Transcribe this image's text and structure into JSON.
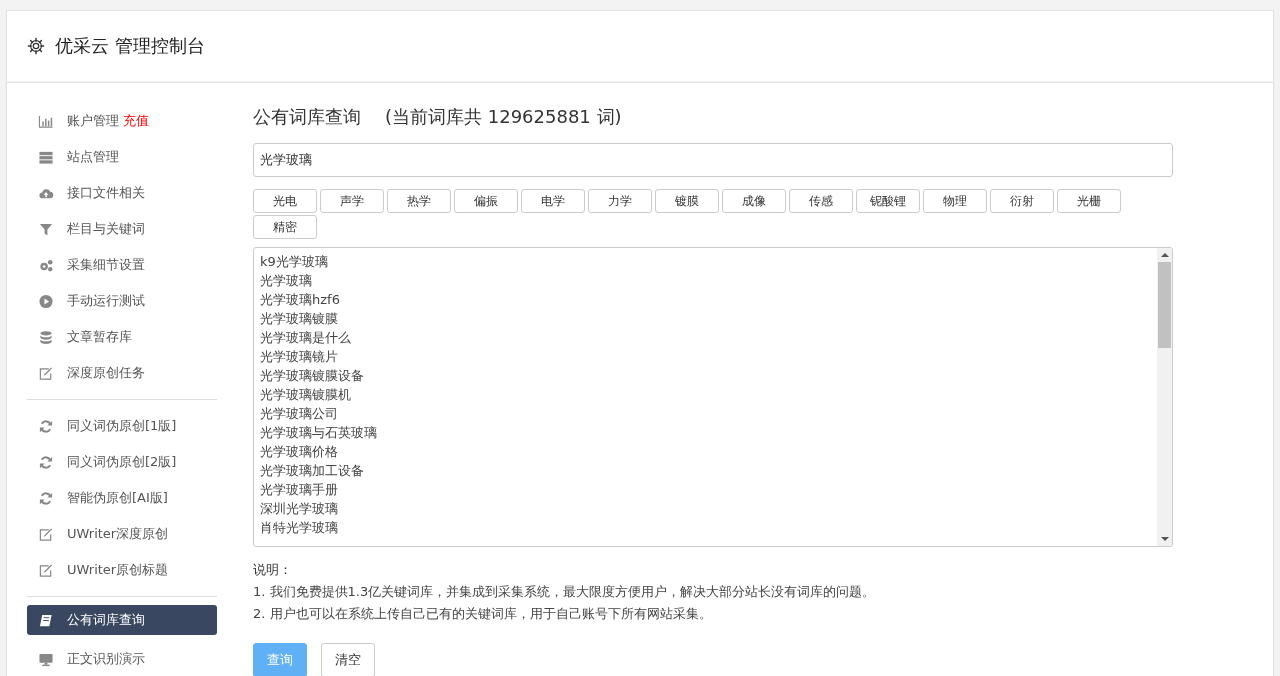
{
  "header": {
    "title": "优采云 管理控制台"
  },
  "sidebar": {
    "groups": [
      {
        "items": [
          {
            "label": "账户管理",
            "badge": "充值",
            "selected": false
          },
          {
            "label": "站点管理",
            "selected": false
          },
          {
            "label": "接口文件相关",
            "selected": false
          },
          {
            "label": "栏目与关键词",
            "selected": false
          },
          {
            "label": "采集细节设置",
            "selected": false
          },
          {
            "label": "手动运行测试",
            "selected": false
          },
          {
            "label": "文章暂存库",
            "selected": false
          },
          {
            "label": "深度原创任务",
            "selected": false
          }
        ]
      },
      {
        "items": [
          {
            "label": "同义词伪原创[1版]",
            "selected": false
          },
          {
            "label": "同义词伪原创[2版]",
            "selected": false
          },
          {
            "label": "智能伪原创[AI版]",
            "selected": false
          },
          {
            "label": "UWriter深度原创",
            "selected": false
          },
          {
            "label": "UWriter原创标题",
            "selected": false
          }
        ]
      },
      {
        "items": [
          {
            "label": "公有词库查询",
            "selected": true
          },
          {
            "label": "正文识别演示",
            "selected": false
          }
        ]
      }
    ]
  },
  "main": {
    "title": "公有词库查询",
    "subtitle": "(当前词库共 129625881 词)",
    "search": {
      "value": "光学玻璃"
    },
    "tags": [
      "光电",
      "声学",
      "热学",
      "偏振",
      "电学",
      "力学",
      "镀膜",
      "成像",
      "传感",
      "铌酸锂",
      "物理",
      "衍射",
      "光栅",
      "精密"
    ],
    "results": [
      "k9光学玻璃",
      "光学玻璃",
      "光学玻璃hzf6",
      "光学玻璃镀膜",
      "光学玻璃是什么",
      "光学玻璃镜片",
      "光学玻璃镀膜设备",
      "光学玻璃镀膜机",
      "光学玻璃公司",
      "光学玻璃与石英玻璃",
      "光学玻璃价格",
      "光学玻璃加工设备",
      "光学玻璃手册",
      "深圳光学玻璃",
      "肖特光学玻璃"
    ],
    "notes_title": "说明：",
    "notes": [
      "1. 我们免费提供1.3亿关键词库，并集成到采集系统，最大限度方便用户，解决大部分站长没有词库的问题。",
      "2. 用户也可以在系统上传自己已有的关键词库，用于自己账号下所有网站采集。"
    ],
    "buttons": [
      {
        "label": "查询",
        "kind": "primary"
      },
      {
        "label": "清空",
        "kind": "default"
      }
    ]
  }
}
